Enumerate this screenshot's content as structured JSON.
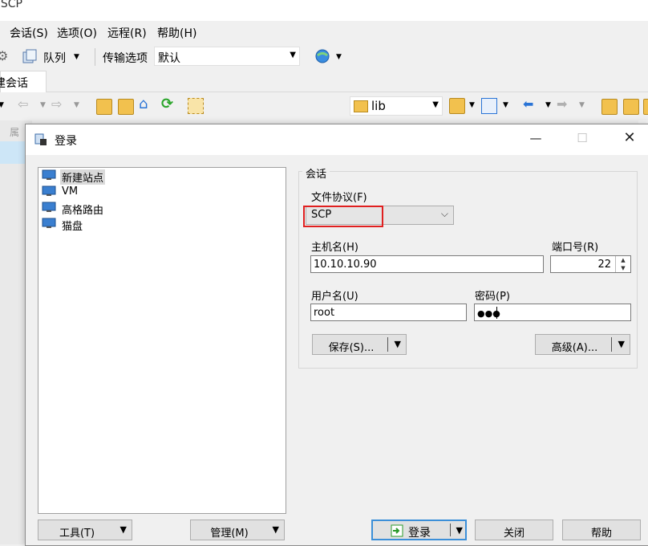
{
  "app": {
    "title_fragment": "nSCP"
  },
  "menu": [
    {
      "label": "会话(S)"
    },
    {
      "label": "选项(O)"
    },
    {
      "label": "远程(R)"
    },
    {
      "label": "帮助(H)"
    }
  ],
  "toolbar": {
    "queue_label": "队列",
    "transfer_label": "传输选项",
    "transfer_value": "默认"
  },
  "tabs": {
    "new_session": "建会话"
  },
  "remote_nav": {
    "path": "lib"
  },
  "left_pane": {
    "col_fragment": "属"
  },
  "dialog": {
    "title": "登录",
    "sites": [
      {
        "label": "新建站点",
        "selected": true
      },
      {
        "label": "VM"
      },
      {
        "label": "高格路由"
      },
      {
        "label": "猫盘"
      }
    ],
    "session": {
      "group_label": "会话",
      "protocol_label": "文件协议(F)",
      "protocol_value": "SCP",
      "host_label": "主机名(H)",
      "host_value": "10.10.10.90",
      "port_label": "端口号(R)",
      "port_value": "22",
      "user_label": "用户名(U)",
      "user_value": "root",
      "password_label": "密码(P)",
      "password_value": "●●●",
      "save_label": "保存(S)...",
      "advanced_label": "高级(A)..."
    },
    "buttons": {
      "tools": "工具(T)",
      "manage": "管理(M)",
      "login": "登录",
      "close": "关闭",
      "help": "帮助"
    }
  },
  "colors": {
    "highlight": "#e02020",
    "accent": "#3c8fd8"
  }
}
